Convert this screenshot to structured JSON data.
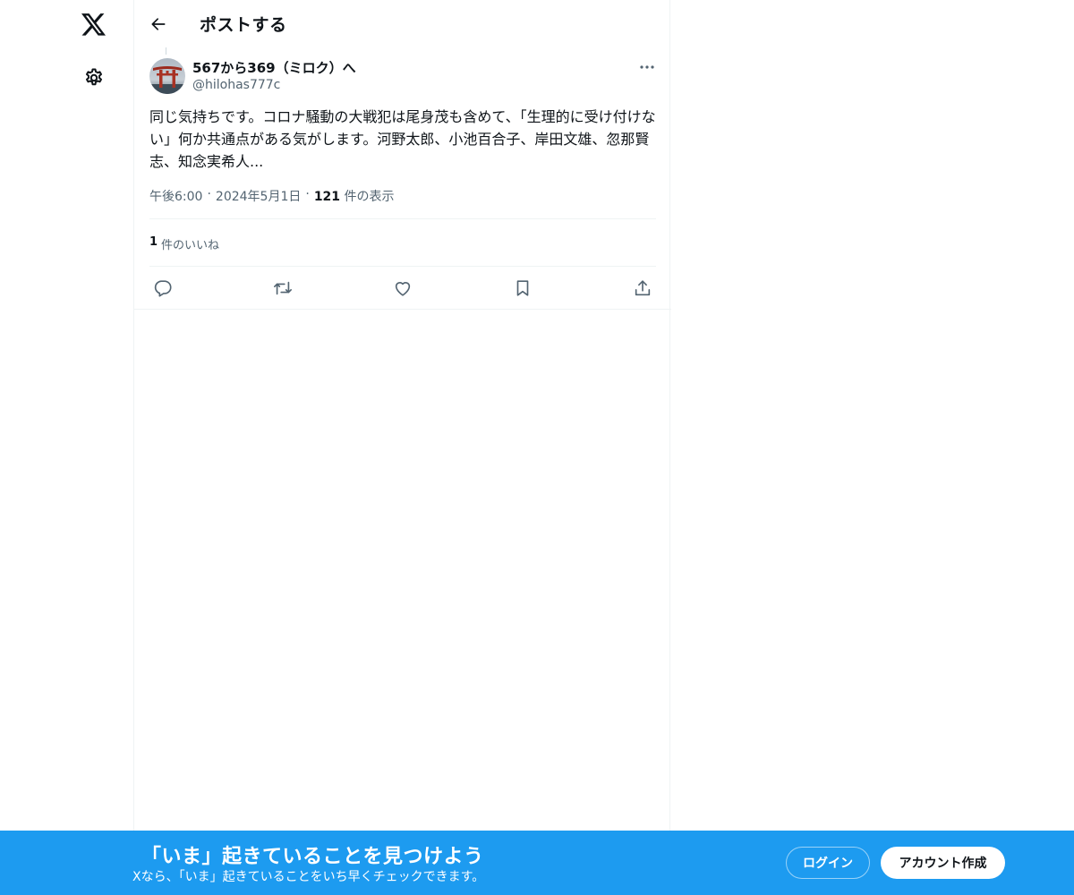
{
  "nav": {
    "logo_icon": "x-logo-icon",
    "settings_icon": "gear-icon"
  },
  "header": {
    "back_icon": "arrow-left-icon",
    "title": "ポストする"
  },
  "post": {
    "author": {
      "display_name": "567から369（ミロク）へ",
      "handle": "@hilohas777c",
      "avatar_icon": "torii-gate-avatar"
    },
    "more_icon": "more-horizontal-icon",
    "text": "同じ気持ちです。コロナ騒動の大戦犯は尾身茂も含めて、「生理的に受け付けない」何か共通点がある気がします。河野太郎、小池百合子、岸田文雄、忽那賢志、知念実希人...",
    "time": "午後6:00",
    "separator": "·",
    "date": "2024年5月1日",
    "views_count": "121",
    "views_label": "件の表示",
    "likes_count": "1",
    "likes_label": "件のいいね",
    "actions": [
      {
        "name": "reply",
        "icon": "reply-icon"
      },
      {
        "name": "repost",
        "icon": "repost-icon"
      },
      {
        "name": "like",
        "icon": "heart-icon"
      },
      {
        "name": "bookmark",
        "icon": "bookmark-icon"
      },
      {
        "name": "share",
        "icon": "share-icon"
      }
    ]
  },
  "banner": {
    "title": "「いま」起きていることを見つけよう",
    "subtitle": "Xなら、「いま」起きていることをいち早くチェックできます。",
    "login_label": "ログイン",
    "signup_label": "アカウント作成"
  },
  "colors": {
    "accent": "#1d9bf0",
    "text": "#0f1419",
    "secondary_text": "#536471",
    "border": "#eff3f4"
  }
}
